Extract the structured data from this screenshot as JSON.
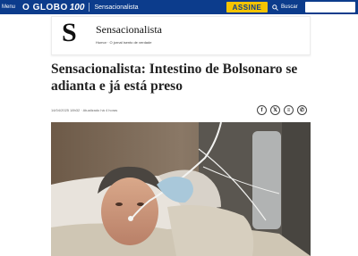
{
  "topbar": {
    "menu_label": "Menu",
    "brand": "O GLOBO",
    "brand_number": "100",
    "section": "Sensacionalista",
    "subscribe_label": "ASSINE",
    "search_label": "Buscar"
  },
  "column": {
    "logo_letter": "S",
    "name": "Sensacionalista",
    "tagline": "Humor · O jornal isento de verdade"
  },
  "article": {
    "headline": "Sensacionalista: Intestino de Bolsonaro se adianta e já está preso",
    "meta": "14/04/2025 18h32 · Atualizado há 4 horas"
  },
  "share": {
    "facebook": "f",
    "x": "𝕏",
    "threads": "≡",
    "whatsapp": "✆"
  },
  "colors": {
    "topbar_bg": "#0c3c8c",
    "subscribe_bg": "#f5c400"
  }
}
